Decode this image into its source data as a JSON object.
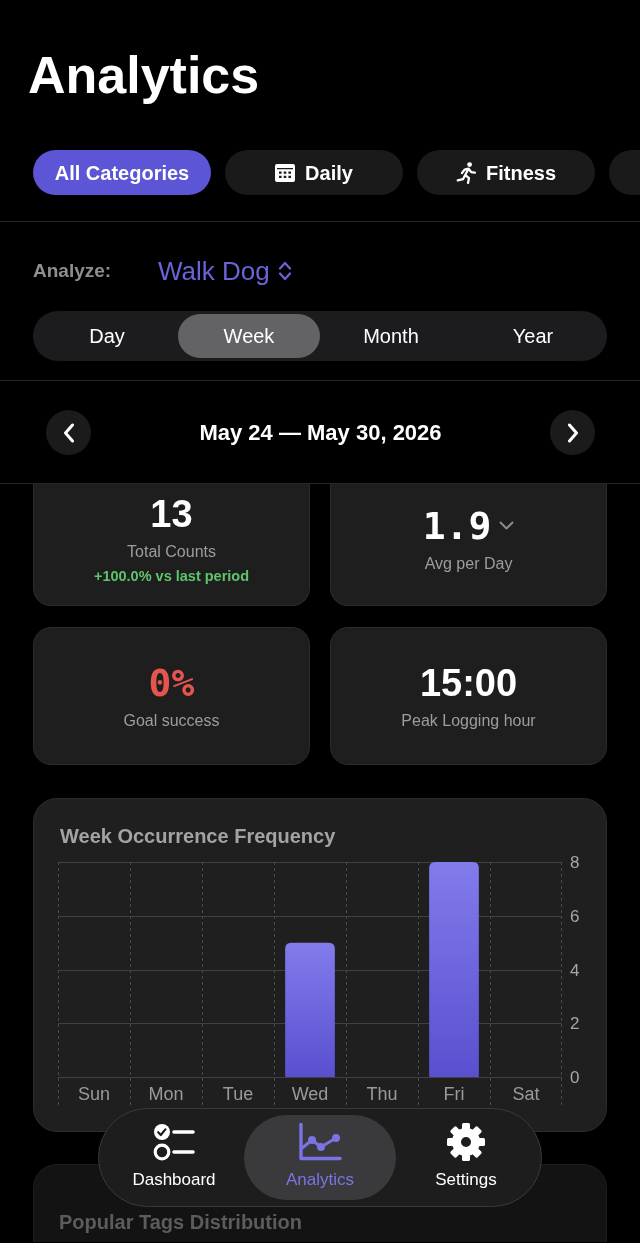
{
  "screen": {
    "title": "Analytics"
  },
  "categories": [
    {
      "label": "All Categories",
      "selected": true
    },
    {
      "label": "Daily",
      "selected": false
    },
    {
      "label": "Fitness",
      "selected": false
    },
    {
      "selected": false
    }
  ],
  "analyze": {
    "label": "Analyze:",
    "value": "Walk Dog"
  },
  "periods": [
    {
      "label": "Day",
      "selected": false
    },
    {
      "label": "Week",
      "selected": true
    },
    {
      "label": "Month",
      "selected": false
    },
    {
      "label": "Year",
      "selected": false
    }
  ],
  "date_range": {
    "label": "May 24 — May 30, 2026"
  },
  "stats": [
    {
      "kind": "count",
      "value": "13",
      "label": "Total Counts",
      "trend": "+100.0% vs last period"
    },
    {
      "kind": "average",
      "value": "1.9",
      "label": "Avg per Day"
    },
    {
      "kind": "goal",
      "value": "0%",
      "label": "Goal success"
    },
    {
      "kind": "time",
      "value": "15:00",
      "label": "Peak Logging hour"
    }
  ],
  "frequency_card": {
    "chart_data": {
      "type": "bar",
      "title": "Week Occurrence Frequency",
      "categories": [
        "Sun",
        "Mon",
        "Tue",
        "Wed",
        "Thu",
        "Fri",
        "Sat"
      ],
      "values": [
        0,
        0,
        0,
        5,
        0,
        8,
        0
      ],
      "ylim": [
        0,
        8
      ],
      "yticks": [
        0,
        2,
        4,
        6,
        8
      ],
      "grid": true
    }
  },
  "tags_card": {
    "title": "Popular Tags Distribution"
  },
  "tab_bar": [
    {
      "label": "Dashboard",
      "selected": false
    },
    {
      "label": "Analytics",
      "selected": true
    },
    {
      "label": "Settings",
      "selected": false
    }
  ]
}
